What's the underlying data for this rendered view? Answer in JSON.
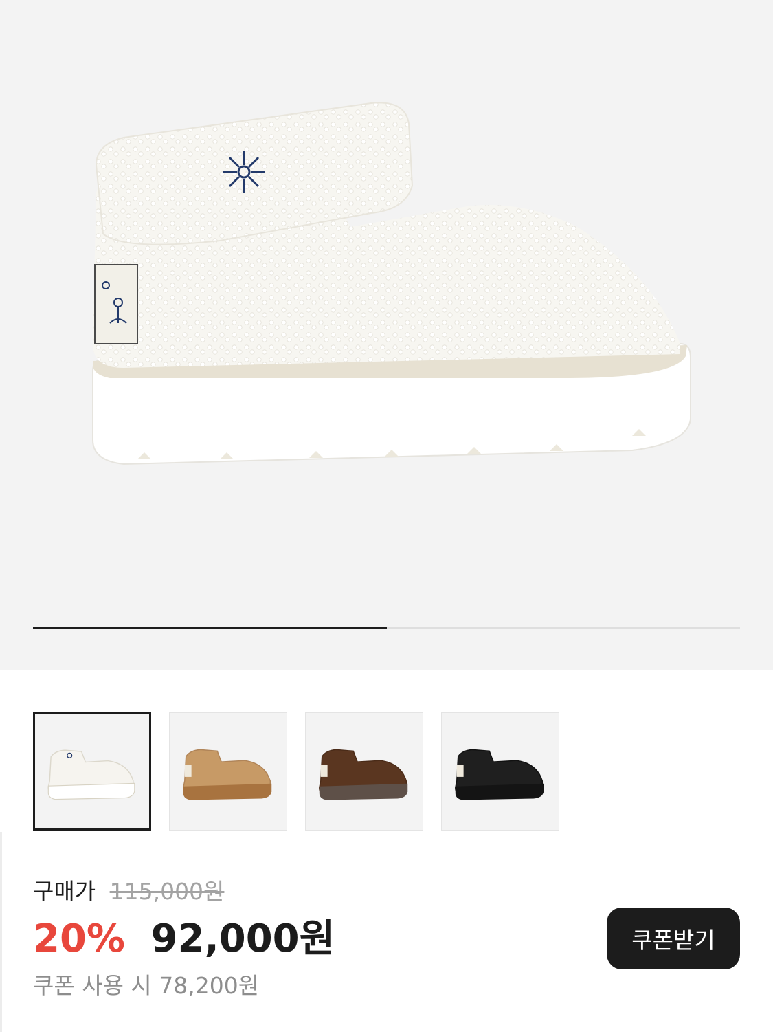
{
  "gallery": {
    "progress": 0.5,
    "progress_color": "#1c1c1c",
    "track_color": "#dedede",
    "main_image_icon": "white-shearling-boot-image"
  },
  "thumbnails": [
    {
      "icon": "white-boot-thumbnail",
      "color": "#f6f4ef",
      "selected": true
    },
    {
      "icon": "tan-boot-thumbnail",
      "color": "#c79a66",
      "selected": false
    },
    {
      "icon": "brown-boot-thumbnail",
      "color": "#5a3620",
      "selected": false
    },
    {
      "icon": "black-boot-thumbnail",
      "color": "#1f1f1f",
      "selected": false
    }
  ],
  "price": {
    "label": "구매가",
    "original": "115,000원",
    "discount": "20%",
    "sale": "92,000원",
    "coupon_text": "쿠폰 사용 시 78,200원",
    "discount_color": "#e8473c"
  },
  "coupon_button": {
    "label": "쿠폰받기"
  }
}
